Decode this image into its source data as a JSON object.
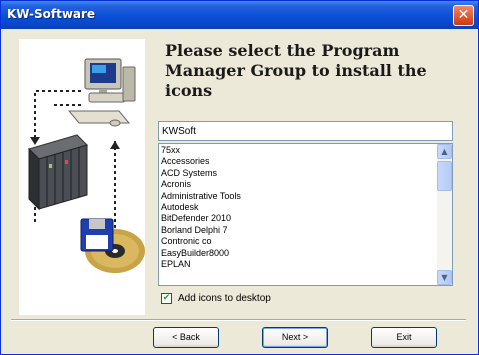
{
  "window": {
    "title": "KW-Software",
    "close_glyph": "✕"
  },
  "heading": "Please select the Program Manager Group to install the icons",
  "group_input": {
    "value": "KWSoft"
  },
  "program_groups": [
    "75xx",
    "Accessories",
    "ACD Systems",
    "Acronis",
    "Administrative Tools",
    "Autodesk",
    "BitDefender 2010",
    "Borland Delphi 7",
    "Contronic co",
    "EasyBuilder8000",
    "EPLAN"
  ],
  "scrollbar": {
    "up_glyph": "▲",
    "down_glyph": "▼"
  },
  "desktop_icons": {
    "label": "Add icons to desktop",
    "checked": true,
    "check_glyph": "✔"
  },
  "buttons": {
    "back": "< Back",
    "next": "Next >",
    "exit": "Exit"
  },
  "colors": {
    "titlebar": "#0a4fd8",
    "close_button": "#e0552e",
    "dialog_background": "#ece9d8"
  },
  "icons": {
    "illustration": "computer-plc-disk-illustration"
  }
}
